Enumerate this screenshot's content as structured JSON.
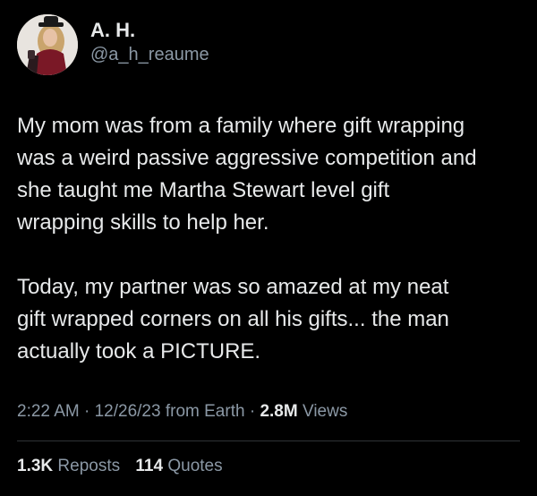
{
  "author": {
    "display_name": "A. H.",
    "handle": "@a_h_reaume",
    "avatar_icon": "profile-photo"
  },
  "tweet": {
    "paragraphs": [
      "My mom was from a family where gift wrapping\nwas a weird passive aggressive competition and\nshe taught me Martha Stewart level gift\nwrapping skills to help her.",
      "Today, my partner was so amazed at my neat\ngift wrapped corners on all his gifts... the man\nactually took a PICTURE."
    ]
  },
  "meta": {
    "time": "2:22 AM",
    "separator": "·",
    "date": "12/26/23",
    "source": "from Earth",
    "views_count": "2.8M",
    "views_label": "Views"
  },
  "stats": {
    "reposts_count": "1.3K",
    "reposts_label": "Reposts",
    "quotes_count": "114",
    "quotes_label": "Quotes"
  },
  "colors": {
    "background": "#000000",
    "primary_text": "#e7e9ea",
    "secondary_text": "#8b98a5",
    "divider": "#2f3336"
  }
}
